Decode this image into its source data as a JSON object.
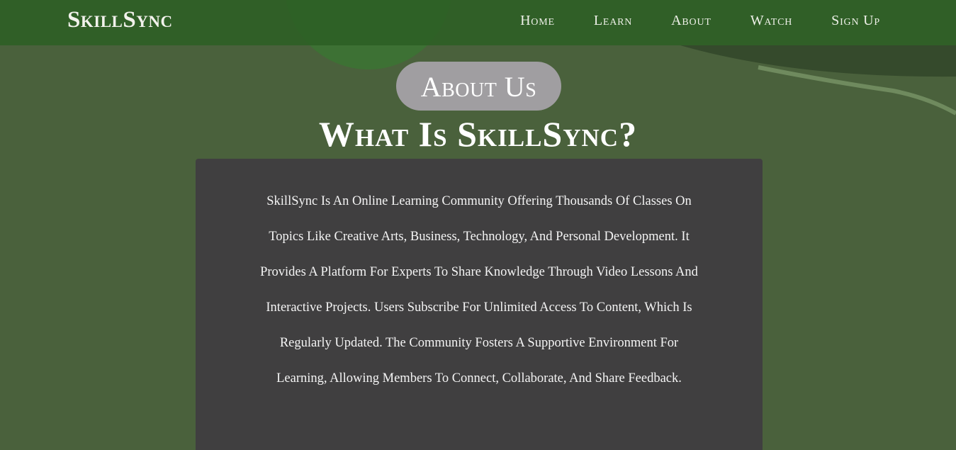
{
  "brand": {
    "name": "SkillSync"
  },
  "nav": {
    "items": [
      {
        "label": "Home"
      },
      {
        "label": "Learn"
      },
      {
        "label": "About"
      },
      {
        "label": "Watch"
      },
      {
        "label": "Sign Up"
      }
    ]
  },
  "hero": {
    "badge": "About Us",
    "heading": "What Is SkillSync?"
  },
  "content": {
    "paragraph": "SkillSync Is An Online Learning Community Offering Thousands Of Classes On Topics Like Creative Arts, Business, Technology, And Personal Development. It Provides A Platform For Experts To Share Knowledge Through Video Lessons And Interactive Projects. Users Subscribe For Unlimited Access To Content, Which Is Regularly Updated. The Community Fosters A Supportive Environment For Learning, Allowing Members To Connect, Collaborate, And Share Feedback."
  },
  "colors": {
    "nav_background": "#2c5e24",
    "page_background": "#4a613c",
    "badge_background": "#a09ea1",
    "content_background": "#403f40",
    "text": "#ffffff"
  }
}
